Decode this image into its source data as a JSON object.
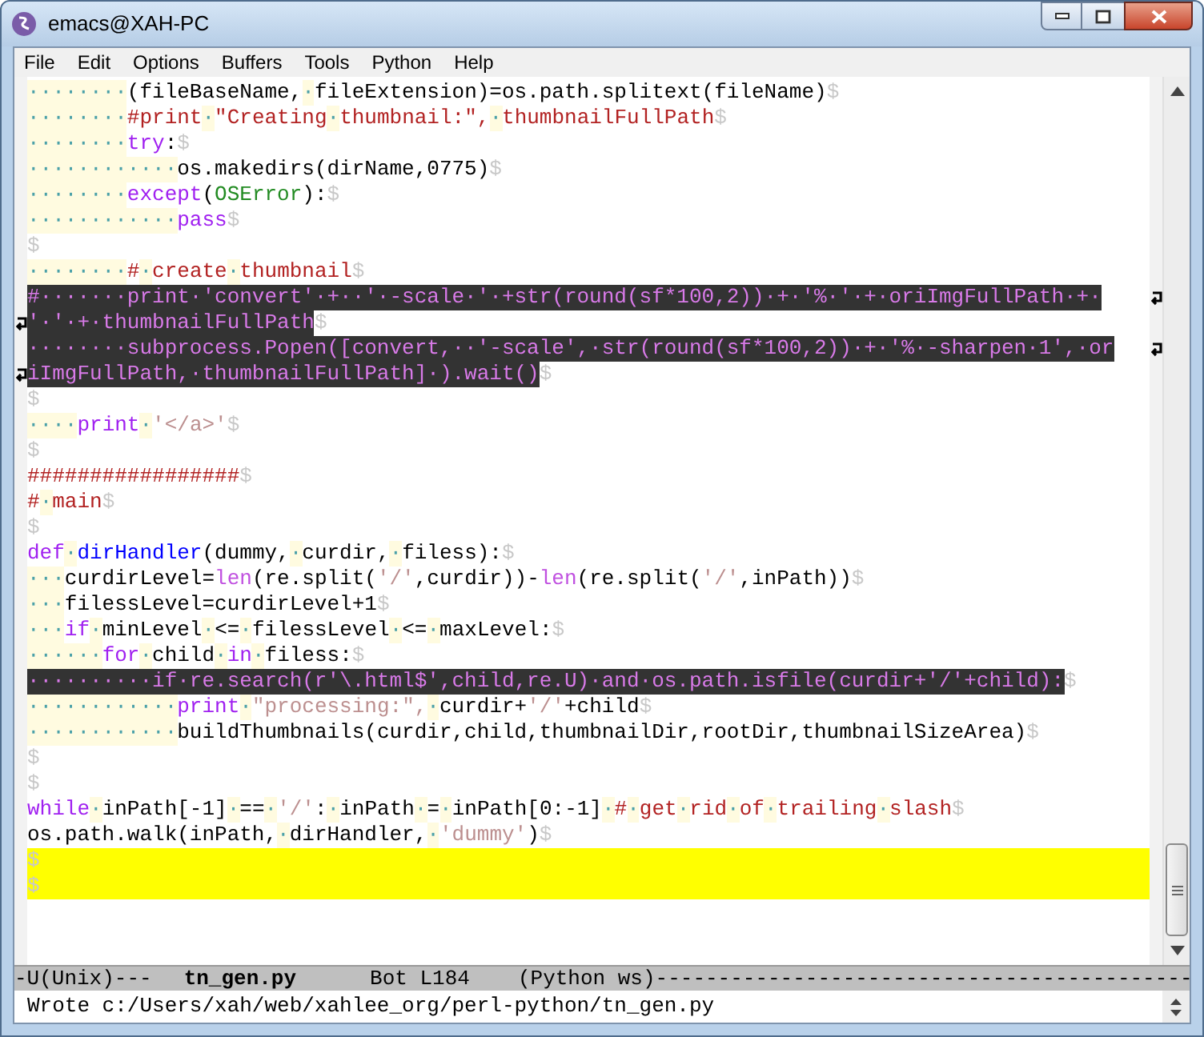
{
  "window": {
    "title": "emacs@XAH-PC"
  },
  "menu": [
    "File",
    "Edit",
    "Options",
    "Buffers",
    "Tools",
    "Python",
    "Help"
  ],
  "lines": [
    {
      "kind": "normal",
      "tokens": [
        {
          "kind": "space",
          "text": "········"
        },
        {
          "kind": "plain",
          "text": "(fileBaseName,"
        },
        {
          "kind": "space",
          "text": "·"
        },
        {
          "kind": "plain",
          "text": "fileExtension)=os.path.splitext(fileName)"
        },
        {
          "kind": "eol",
          "text": "$"
        }
      ]
    },
    {
      "kind": "normal",
      "tokens": [
        {
          "kind": "space",
          "text": "········"
        },
        {
          "kind": "comment",
          "text": "#print"
        },
        {
          "kind": "space",
          "text": "·"
        },
        {
          "kind": "comment",
          "text": "\"Creating"
        },
        {
          "kind": "space",
          "text": "·"
        },
        {
          "kind": "comment",
          "text": "thumbnail:\","
        },
        {
          "kind": "space",
          "text": "·"
        },
        {
          "kind": "comment",
          "text": "thumbnailFullPath"
        },
        {
          "kind": "eol",
          "text": "$"
        }
      ]
    },
    {
      "kind": "normal",
      "tokens": [
        {
          "kind": "space",
          "text": "········"
        },
        {
          "kind": "keyword",
          "text": "try"
        },
        {
          "kind": "plain",
          "text": ":"
        },
        {
          "kind": "eol",
          "text": "$"
        }
      ]
    },
    {
      "kind": "normal",
      "tokens": [
        {
          "kind": "space",
          "text": "············"
        },
        {
          "kind": "plain",
          "text": "os.makedirs(dirName,0775)"
        },
        {
          "kind": "eol",
          "text": "$"
        }
      ]
    },
    {
      "kind": "normal",
      "tokens": [
        {
          "kind": "space",
          "text": "········"
        },
        {
          "kind": "keyword",
          "text": "except"
        },
        {
          "kind": "plain",
          "text": "("
        },
        {
          "kind": "type",
          "text": "OSError"
        },
        {
          "kind": "plain",
          "text": "):"
        },
        {
          "kind": "eol",
          "text": "$"
        }
      ]
    },
    {
      "kind": "normal",
      "tokens": [
        {
          "kind": "space",
          "text": "············"
        },
        {
          "kind": "keyword",
          "text": "pass"
        },
        {
          "kind": "eol",
          "text": "$"
        }
      ]
    },
    {
      "kind": "normal",
      "tokens": [
        {
          "kind": "eol",
          "text": "$"
        }
      ]
    },
    {
      "kind": "normal",
      "tokens": [
        {
          "kind": "space",
          "text": "········"
        },
        {
          "kind": "comment",
          "text": "#"
        },
        {
          "kind": "space",
          "text": "·"
        },
        {
          "kind": "comment",
          "text": "create"
        },
        {
          "kind": "space",
          "text": "·"
        },
        {
          "kind": "comment",
          "text": "thumbnail"
        },
        {
          "kind": "eol",
          "text": "$"
        }
      ]
    },
    {
      "kind": "long",
      "wrapped": true,
      "continued": false,
      "tokens": [
        {
          "kind": "plain",
          "text": "#·······print·'convert'·+··'·-scale·'·+str(round(sf*100,2))·+·'%·'·+·oriImgFullPath·+·"
        }
      ]
    },
    {
      "kind": "long",
      "wrapped": false,
      "continued": true,
      "tokens": [
        {
          "kind": "plain",
          "text": "'·'·+·thumbnailFullPath"
        },
        {
          "kind": "eol",
          "text": "$"
        }
      ]
    },
    {
      "kind": "long",
      "wrapped": true,
      "continued": false,
      "tokens": [
        {
          "kind": "plain",
          "text": "········subprocess.Popen([convert,··'-scale',·str(round(sf*100,2))·+·'%·-sharpen·1',·or"
        }
      ]
    },
    {
      "kind": "long",
      "wrapped": false,
      "continued": true,
      "tokens": [
        {
          "kind": "plain",
          "text": "iImgFullPath,·thumbnailFullPath]·).wait()"
        },
        {
          "kind": "eol",
          "text": "$"
        }
      ]
    },
    {
      "kind": "normal",
      "tokens": [
        {
          "kind": "eol",
          "text": "$"
        }
      ]
    },
    {
      "kind": "normal",
      "tokens": [
        {
          "kind": "space",
          "text": "····"
        },
        {
          "kind": "keyword",
          "text": "print"
        },
        {
          "kind": "space",
          "text": "·"
        },
        {
          "kind": "string",
          "text": "'</a>'"
        },
        {
          "kind": "eol",
          "text": "$"
        }
      ]
    },
    {
      "kind": "normal",
      "tokens": [
        {
          "kind": "eol",
          "text": "$"
        }
      ]
    },
    {
      "kind": "normal",
      "tokens": [
        {
          "kind": "comment",
          "text": "#################"
        },
        {
          "kind": "eol",
          "text": "$"
        }
      ]
    },
    {
      "kind": "normal",
      "tokens": [
        {
          "kind": "comment",
          "text": "#"
        },
        {
          "kind": "space",
          "text": "·"
        },
        {
          "kind": "comment",
          "text": "main"
        },
        {
          "kind": "eol",
          "text": "$"
        }
      ]
    },
    {
      "kind": "normal",
      "tokens": [
        {
          "kind": "eol",
          "text": "$"
        }
      ]
    },
    {
      "kind": "normal",
      "tokens": [
        {
          "kind": "keyword",
          "text": "def"
        },
        {
          "kind": "space",
          "text": "·"
        },
        {
          "kind": "function",
          "text": "dirHandler"
        },
        {
          "kind": "plain",
          "text": "(dummy,"
        },
        {
          "kind": "space",
          "text": "·"
        },
        {
          "kind": "plain",
          "text": "curdir,"
        },
        {
          "kind": "space",
          "text": "·"
        },
        {
          "kind": "plain",
          "text": "filess):"
        },
        {
          "kind": "eol",
          "text": "$"
        }
      ]
    },
    {
      "kind": "normal",
      "tokens": [
        {
          "kind": "space",
          "text": "···"
        },
        {
          "kind": "plain",
          "text": "curdirLevel="
        },
        {
          "kind": "builtin",
          "text": "len"
        },
        {
          "kind": "plain",
          "text": "(re.split("
        },
        {
          "kind": "string",
          "text": "'/'"
        },
        {
          "kind": "plain",
          "text": ",curdir))-"
        },
        {
          "kind": "builtin",
          "text": "len"
        },
        {
          "kind": "plain",
          "text": "(re.split("
        },
        {
          "kind": "string",
          "text": "'/'"
        },
        {
          "kind": "plain",
          "text": ",inPath))"
        },
        {
          "kind": "eol",
          "text": "$"
        }
      ]
    },
    {
      "kind": "normal",
      "tokens": [
        {
          "kind": "space",
          "text": "···"
        },
        {
          "kind": "plain",
          "text": "filessLevel=curdirLevel+1"
        },
        {
          "kind": "eol",
          "text": "$"
        }
      ]
    },
    {
      "kind": "normal",
      "tokens": [
        {
          "kind": "space",
          "text": "···"
        },
        {
          "kind": "keyword",
          "text": "if"
        },
        {
          "kind": "space",
          "text": "·"
        },
        {
          "kind": "plain",
          "text": "minLevel"
        },
        {
          "kind": "space",
          "text": "·"
        },
        {
          "kind": "plain",
          "text": "<="
        },
        {
          "kind": "space",
          "text": "·"
        },
        {
          "kind": "plain",
          "text": "filessLevel"
        },
        {
          "kind": "space",
          "text": "·"
        },
        {
          "kind": "plain",
          "text": "<="
        },
        {
          "kind": "space",
          "text": "·"
        },
        {
          "kind": "plain",
          "text": "maxLevel:"
        },
        {
          "kind": "eol",
          "text": "$"
        }
      ]
    },
    {
      "kind": "normal",
      "tokens": [
        {
          "kind": "space",
          "text": "······"
        },
        {
          "kind": "keyword",
          "text": "for"
        },
        {
          "kind": "space",
          "text": "·"
        },
        {
          "kind": "plain",
          "text": "child"
        },
        {
          "kind": "space",
          "text": "·"
        },
        {
          "kind": "keyword",
          "text": "in"
        },
        {
          "kind": "space",
          "text": "·"
        },
        {
          "kind": "plain",
          "text": "filess:"
        },
        {
          "kind": "eol",
          "text": "$"
        }
      ]
    },
    {
      "kind": "long",
      "tokens": [
        {
          "kind": "plain",
          "text": "··········if·re.search(r'\\.html$',child,re.U)·and·os.path.isfile(curdir+'/'+child):"
        },
        {
          "kind": "eol",
          "text": "$"
        }
      ]
    },
    {
      "kind": "normal",
      "tokens": [
        {
          "kind": "space",
          "text": "············"
        },
        {
          "kind": "keyword",
          "text": "print"
        },
        {
          "kind": "space",
          "text": "·"
        },
        {
          "kind": "string",
          "text": "\"processing:\","
        },
        {
          "kind": "space",
          "text": "·"
        },
        {
          "kind": "plain",
          "text": "curdir+"
        },
        {
          "kind": "string",
          "text": "'/'"
        },
        {
          "kind": "plain",
          "text": "+child"
        },
        {
          "kind": "eol",
          "text": "$"
        }
      ]
    },
    {
      "kind": "normal",
      "tokens": [
        {
          "kind": "space",
          "text": "············"
        },
        {
          "kind": "plain",
          "text": "buildThumbnails(curdir,child,thumbnailDir,rootDir,thumbnailSizeArea)"
        },
        {
          "kind": "eol",
          "text": "$"
        }
      ]
    },
    {
      "kind": "normal",
      "tokens": [
        {
          "kind": "eol",
          "text": "$"
        }
      ]
    },
    {
      "kind": "normal",
      "tokens": [
        {
          "kind": "eol",
          "text": "$"
        }
      ]
    },
    {
      "kind": "normal",
      "tokens": [
        {
          "kind": "keyword",
          "text": "while"
        },
        {
          "kind": "space",
          "text": "·"
        },
        {
          "kind": "plain",
          "text": "inPath[-1]"
        },
        {
          "kind": "space",
          "text": "·"
        },
        {
          "kind": "plain",
          "text": "=="
        },
        {
          "kind": "space",
          "text": "·"
        },
        {
          "kind": "string",
          "text": "'/'"
        },
        {
          "kind": "plain",
          "text": ":"
        },
        {
          "kind": "space",
          "text": "·"
        },
        {
          "kind": "plain",
          "text": "inPath"
        },
        {
          "kind": "space",
          "text": "·"
        },
        {
          "kind": "plain",
          "text": "="
        },
        {
          "kind": "space",
          "text": "·"
        },
        {
          "kind": "plain",
          "text": "inPath[0:-1]"
        },
        {
          "kind": "space",
          "text": "·"
        },
        {
          "kind": "comment",
          "text": "#"
        },
        {
          "kind": "space",
          "text": "·"
        },
        {
          "kind": "comment",
          "text": "get"
        },
        {
          "kind": "space",
          "text": "·"
        },
        {
          "kind": "comment",
          "text": "rid"
        },
        {
          "kind": "space",
          "text": "·"
        },
        {
          "kind": "comment",
          "text": "of"
        },
        {
          "kind": "space",
          "text": "·"
        },
        {
          "kind": "comment",
          "text": "trailing"
        },
        {
          "kind": "space",
          "text": "·"
        },
        {
          "kind": "comment",
          "text": "slash"
        },
        {
          "kind": "eol",
          "text": "$"
        }
      ]
    },
    {
      "kind": "normal",
      "tokens": [
        {
          "kind": "plain",
          "text": "os.path.walk(inPath,"
        },
        {
          "kind": "space",
          "text": "·"
        },
        {
          "kind": "plain",
          "text": "dirHandler,"
        },
        {
          "kind": "space",
          "text": "·"
        },
        {
          "kind": "string",
          "text": "'dummy'"
        },
        {
          "kind": "plain",
          "text": ")"
        },
        {
          "kind": "eol",
          "text": "$"
        }
      ]
    },
    {
      "kind": "trailing",
      "tokens": [
        {
          "kind": "eol",
          "text": "$"
        }
      ]
    },
    {
      "kind": "trailing",
      "tokens": [
        {
          "kind": "eol",
          "text": "$"
        }
      ]
    }
  ],
  "mode_line": {
    "status": "-U(Unix)---",
    "buffer": "tn_gen.py",
    "position": "Bot L184",
    "mode": "(Python ws)",
    "fill": "-------------------------------------------"
  },
  "minibuffer": "Wrote c:/Users/xah/web/xahlee_org/perl-python/tn_gen.py"
}
